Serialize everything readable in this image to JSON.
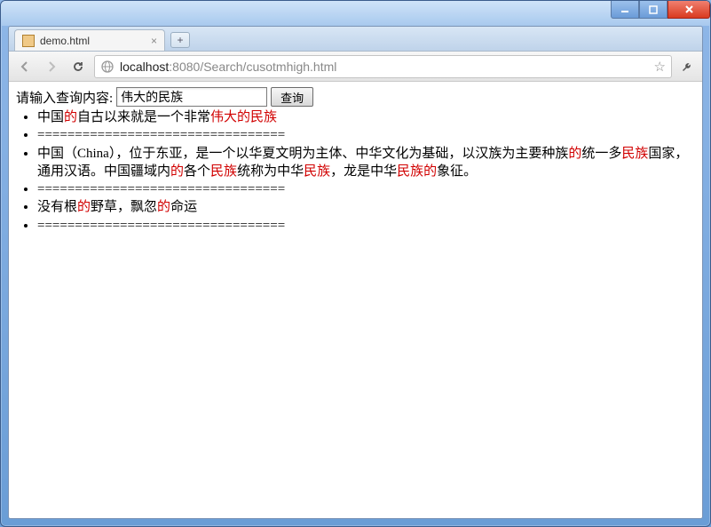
{
  "window": {
    "title": ""
  },
  "tab": {
    "title": "demo.html"
  },
  "url": {
    "host": "localhost",
    "port": ":8080",
    "path": "/Search/cusotmhigh.html"
  },
  "query": {
    "label": "请输入查询内容:",
    "value": "伟大的民族",
    "button": "查询"
  },
  "separator": "=================================",
  "highlight_color": "#d10000",
  "results": [
    {
      "segments": [
        {
          "t": "中国",
          "h": false
        },
        {
          "t": "的",
          "h": true
        },
        {
          "t": "自古以来就是一个非常",
          "h": false
        },
        {
          "t": "伟大的民族",
          "h": true
        }
      ]
    },
    {
      "segments": [
        {
          "t": "中国（China），位于东亚，是一个以华夏文明为主体、中华文化为基础，以汉族为主要种族",
          "h": false
        },
        {
          "t": "的",
          "h": true
        },
        {
          "t": "统一多",
          "h": false
        },
        {
          "t": "民族",
          "h": true
        },
        {
          "t": "国家，通用汉语。中国疆域内",
          "h": false
        },
        {
          "t": "的",
          "h": true
        },
        {
          "t": "各个",
          "h": false
        },
        {
          "t": "民族",
          "h": true
        },
        {
          "t": "统称为中华",
          "h": false
        },
        {
          "t": "民族",
          "h": true
        },
        {
          "t": "，龙是中华",
          "h": false
        },
        {
          "t": "民族的",
          "h": true
        },
        {
          "t": "象征。",
          "h": false
        }
      ]
    },
    {
      "segments": [
        {
          "t": "没有根",
          "h": false
        },
        {
          "t": "的",
          "h": true
        },
        {
          "t": "野草，飘忽",
          "h": false
        },
        {
          "t": "的",
          "h": true
        },
        {
          "t": "命运",
          "h": false
        }
      ]
    }
  ]
}
